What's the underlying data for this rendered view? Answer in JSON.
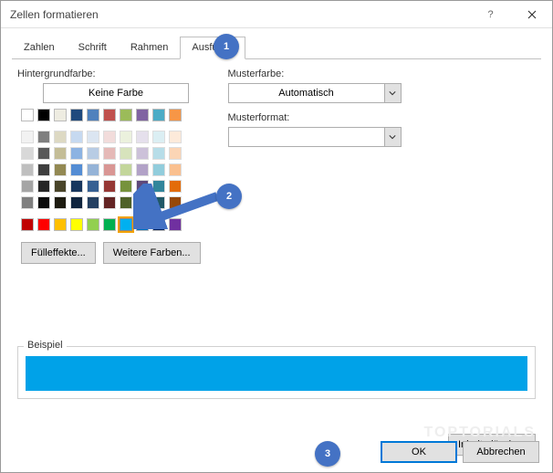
{
  "title": "Zellen formatieren",
  "tabs": [
    "Zahlen",
    "Schrift",
    "Rahmen",
    "Ausfüllen"
  ],
  "active_tab": 3,
  "labels": {
    "bgcolor": "Hintergrundfarbe:",
    "pattern_color": "Musterfarbe:",
    "pattern_format": "Musterformat:",
    "no_color": "Keine Farbe",
    "example": "Beispiel"
  },
  "buttons": {
    "fill_effects": "Fülleffekte...",
    "more_colors": "Weitere Farben...",
    "clear": "Inhalte löschen",
    "ok": "OK",
    "cancel": "Abbrechen"
  },
  "pattern_color_value": "Automatisch",
  "pattern_format_value": "",
  "preview_color": "#00a2e8",
  "markers": {
    "1": "1",
    "2": "2",
    "3": "3"
  },
  "theme_colors_row1": [
    "#ffffff",
    "#000000",
    "#eeece1",
    "#1f497d",
    "#4f81bd",
    "#c0504d",
    "#9bbb59",
    "#8064a2",
    "#4bacc6",
    "#f79646"
  ],
  "theme_shades": [
    [
      "#f2f2f2",
      "#7f7f7f",
      "#ddd9c3",
      "#c6d9f0",
      "#dbe5f1",
      "#f2dcdb",
      "#ebf1dd",
      "#e5e0ec",
      "#dbeef3",
      "#fdeada"
    ],
    [
      "#d8d8d8",
      "#595959",
      "#c4bd97",
      "#8db3e2",
      "#b8cce4",
      "#e5b9b7",
      "#d7e3bc",
      "#ccc1d9",
      "#b7dde8",
      "#fbd5b5"
    ],
    [
      "#bfbfbf",
      "#3f3f3f",
      "#938953",
      "#548dd4",
      "#95b3d7",
      "#d99694",
      "#c3d69b",
      "#b2a2c7",
      "#92cddc",
      "#fac08f"
    ],
    [
      "#a5a5a5",
      "#262626",
      "#494429",
      "#17365d",
      "#366092",
      "#953734",
      "#76923c",
      "#5f497a",
      "#31859b",
      "#e36c09"
    ],
    [
      "#7f7f7f",
      "#0c0c0c",
      "#1d1b10",
      "#0f243e",
      "#244061",
      "#632423",
      "#4f6128",
      "#3f3151",
      "#205867",
      "#974806"
    ]
  ],
  "standard_colors": [
    "#c00000",
    "#ff0000",
    "#ffc000",
    "#ffff00",
    "#92d050",
    "#00b050",
    "#00b0f0",
    "#0070c0",
    "#002060",
    "#7030a0"
  ],
  "selected_standard_index": 6
}
